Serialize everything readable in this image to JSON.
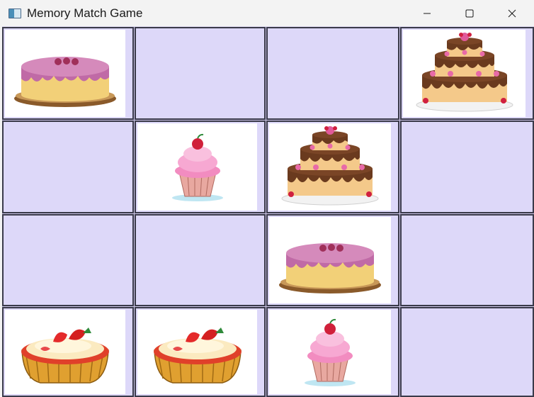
{
  "window": {
    "title": "Memory Match Game"
  },
  "controls": {
    "minimize_icon": "minimize-icon",
    "maximize_icon": "maximize-icon",
    "close_icon": "close-icon"
  },
  "colors": {
    "hidden_card": "#ddd8f9",
    "revealed_card": "#ffffff",
    "grid_line": "#3a3a4a"
  },
  "board": {
    "rows": 4,
    "cols": 4,
    "cards": [
      {
        "row": 0,
        "col": 0,
        "state": "revealed",
        "image": "pink-cake"
      },
      {
        "row": 0,
        "col": 1,
        "state": "hidden",
        "image": ""
      },
      {
        "row": 0,
        "col": 2,
        "state": "hidden",
        "image": ""
      },
      {
        "row": 0,
        "col": 3,
        "state": "revealed",
        "image": "chocolate-tier-cake"
      },
      {
        "row": 1,
        "col": 0,
        "state": "hidden",
        "image": ""
      },
      {
        "row": 1,
        "col": 1,
        "state": "revealed",
        "image": "cupcake"
      },
      {
        "row": 1,
        "col": 2,
        "state": "revealed",
        "image": "chocolate-tier-cake"
      },
      {
        "row": 1,
        "col": 3,
        "state": "hidden",
        "image": ""
      },
      {
        "row": 2,
        "col": 0,
        "state": "hidden",
        "image": ""
      },
      {
        "row": 2,
        "col": 1,
        "state": "hidden",
        "image": ""
      },
      {
        "row": 2,
        "col": 2,
        "state": "revealed",
        "image": "pink-cake"
      },
      {
        "row": 2,
        "col": 3,
        "state": "hidden",
        "image": ""
      },
      {
        "row": 3,
        "col": 0,
        "state": "revealed",
        "image": "strawberry-tart"
      },
      {
        "row": 3,
        "col": 1,
        "state": "revealed",
        "image": "strawberry-tart"
      },
      {
        "row": 3,
        "col": 2,
        "state": "revealed",
        "image": "cupcake"
      },
      {
        "row": 3,
        "col": 3,
        "state": "hidden",
        "image": ""
      }
    ]
  }
}
